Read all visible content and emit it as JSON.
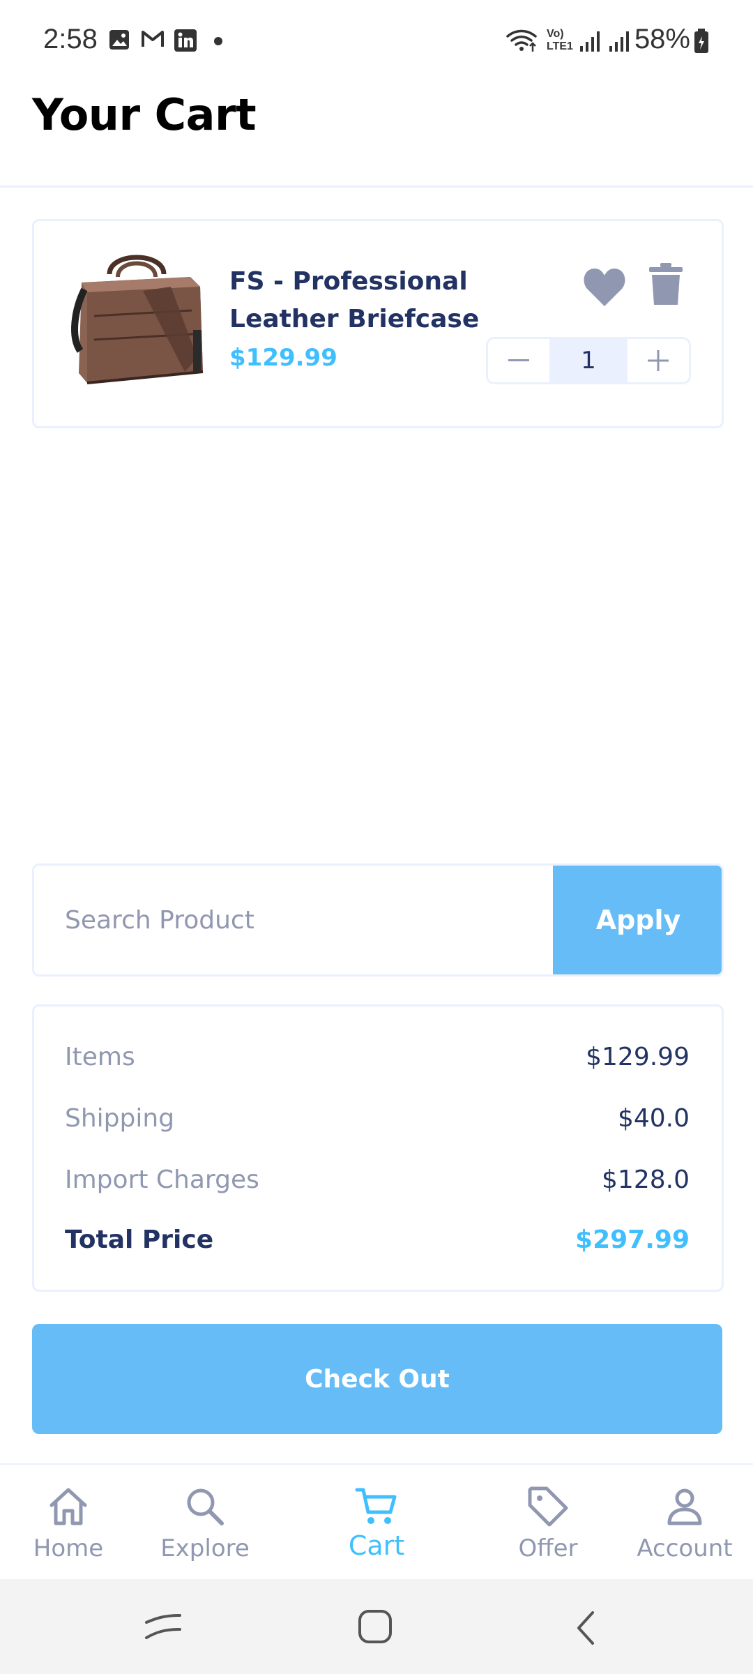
{
  "status_bar": {
    "time": "2:58",
    "battery": "58%"
  },
  "header": {
    "title": "Your Cart"
  },
  "cart_item": {
    "name": "FS - Professional Leather Briefcase",
    "price": "$129.99",
    "quantity": "1",
    "icons": [
      "heart-icon",
      "trash-icon",
      "minus-icon",
      "plus-icon"
    ]
  },
  "coupon": {
    "placeholder": "Search Product",
    "apply_label": "Apply"
  },
  "summary": {
    "items_label": "Items",
    "items_value": "$129.99",
    "shipping_label": "Shipping",
    "shipping_value": "$40.0",
    "import_label": "Import Charges",
    "import_value": "$128.0",
    "total_label": "Total Price",
    "total_value": "$297.99"
  },
  "checkout": {
    "label": "Check Out"
  },
  "bottom_nav": {
    "items": [
      {
        "label": "Home",
        "icon": "home-icon"
      },
      {
        "label": "Explore",
        "icon": "search-icon"
      },
      {
        "label": "Cart",
        "icon": "cart-icon",
        "active": true
      },
      {
        "label": "Offer",
        "icon": "tag-icon"
      },
      {
        "label": "Account",
        "icon": "user-icon"
      }
    ]
  },
  "colors": {
    "accent": "#40BFFF",
    "button": "#66BCF7",
    "text_dark": "#223263",
    "text_muted": "#9098B1",
    "border": "#EBF0FF"
  }
}
